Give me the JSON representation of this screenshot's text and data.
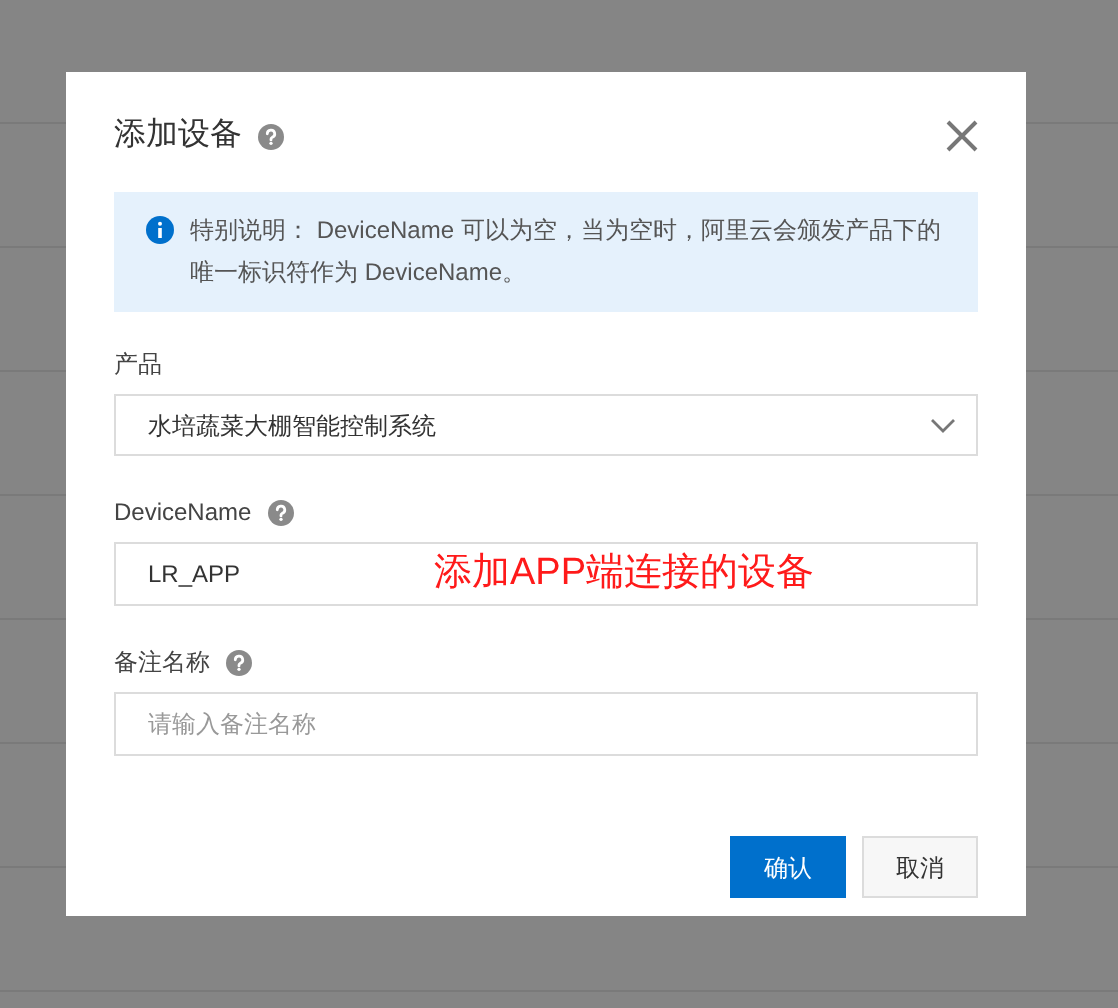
{
  "dialog": {
    "title": "添加设备",
    "notice": "特别说明： DeviceName 可以为空，当为空时，阿里云会颁发产品下的唯一标识符作为 DeviceName。",
    "fields": [
      {
        "kind": "select",
        "label": "产品",
        "help": false,
        "value": "水培蔬菜大棚智能控制系统"
      },
      {
        "kind": "input",
        "label": "DeviceName",
        "help": true,
        "value": "LR_APP"
      },
      {
        "kind": "input",
        "label": "备注名称",
        "help": true,
        "placeholder": "请输入备注名称"
      }
    ],
    "annotation": "添加APP端连接的设备",
    "buttons": [
      {
        "label": "确认",
        "kind": "primary"
      },
      {
        "label": "取消",
        "kind": "secondary"
      }
    ]
  }
}
